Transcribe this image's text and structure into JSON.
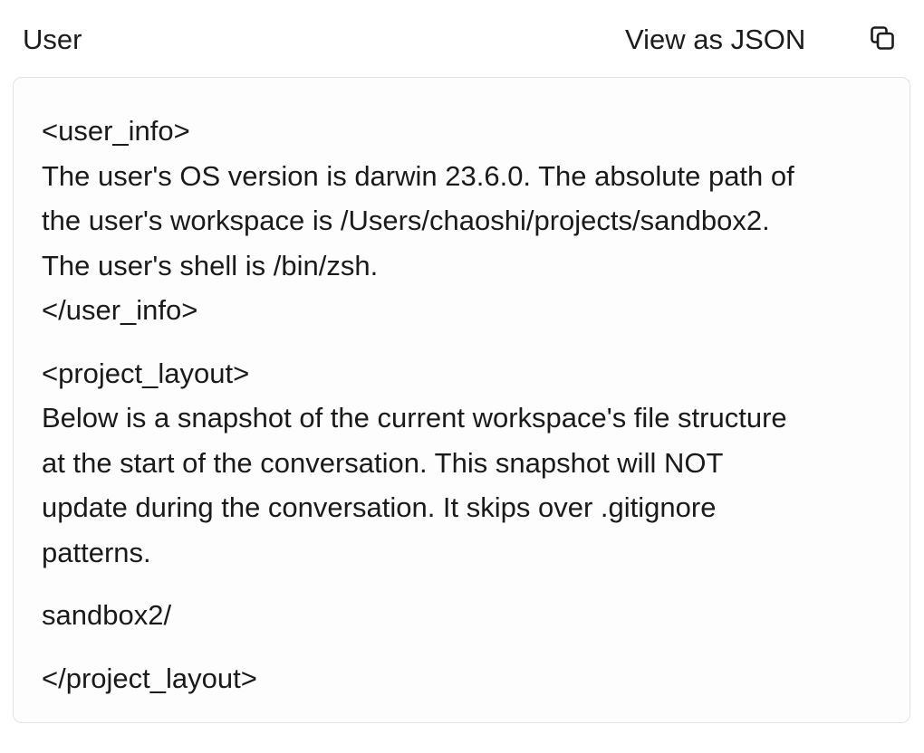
{
  "header": {
    "role": "User",
    "view_json_label": "View as JSON",
    "copy_icon": "copy-icon"
  },
  "message": {
    "user_info": {
      "open_tag": "<user_info>",
      "lines": [
        "The user's OS version is darwin 23.6.0. The absolute path of",
        "the user's workspace is /Users/chaoshi/projects/sandbox2.",
        "The user's shell is /bin/zsh."
      ],
      "close_tag": "</user_info>"
    },
    "project_layout": {
      "open_tag": "<project_layout>",
      "lines": [
        "Below is a snapshot of the current workspace's file structure",
        "at the start of the conversation. This snapshot will NOT",
        "update during the conversation. It skips over .gitignore",
        "patterns."
      ],
      "tree": "sandbox2/",
      "close_tag": "</project_layout>"
    }
  }
}
